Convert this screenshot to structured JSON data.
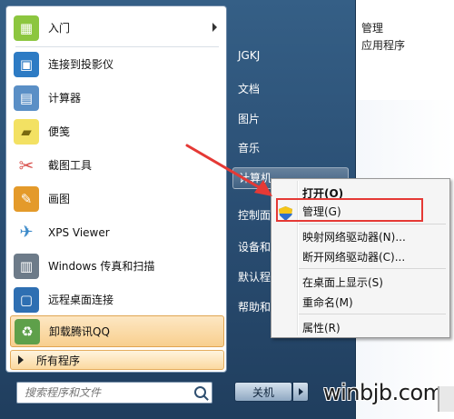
{
  "background_window": {
    "items": [
      "管理",
      "应用程序"
    ]
  },
  "programs": [
    {
      "label": "入门",
      "icon": "getting-started-icon",
      "color": "#8cc63f",
      "has_submenu": true
    },
    {
      "label": "连接到投影仪",
      "icon": "projector-icon",
      "color": "#2d7bc4"
    },
    {
      "label": "计算器",
      "icon": "calculator-icon",
      "color": "#5a8fc6"
    },
    {
      "label": "便笺",
      "icon": "sticky-notes-icon",
      "color": "#f3e163"
    },
    {
      "label": "截图工具",
      "icon": "scissors-icon",
      "color": "#d9534f"
    },
    {
      "label": "画图",
      "icon": "paint-icon",
      "color": "#e49a2a"
    },
    {
      "label": "XPS Viewer",
      "icon": "xps-viewer-icon",
      "color": "#3a89c9"
    },
    {
      "label": "Windows 传真和扫描",
      "icon": "fax-scanner-icon",
      "color": "#6d7b89"
    },
    {
      "label": "远程桌面连接",
      "icon": "remote-desktop-icon",
      "color": "#2e6fb2"
    },
    {
      "label": "卸载腾讯QQ",
      "icon": "uninstall-icon",
      "color": "#5ea04a",
      "highlighted": true
    }
  ],
  "all_programs": "所有程序",
  "search": {
    "placeholder": "搜索程序和文件"
  },
  "right_pane": [
    {
      "label": "JGKJ"
    },
    {
      "label": "文档"
    },
    {
      "label": "图片"
    },
    {
      "label": "音乐"
    },
    {
      "label": "计算机",
      "selected": true
    },
    {
      "label": "控制面"
    },
    {
      "label": "设备和"
    },
    {
      "label": "默认程"
    },
    {
      "label": "帮助和"
    }
  ],
  "shutdown": {
    "label": "关机"
  },
  "context_menu": {
    "items": [
      {
        "label": "打开(O)",
        "bold": true
      },
      {
        "label": "管理(G)",
        "icon": "uac-shield-icon"
      },
      {
        "label": "映射网络驱动器(N)..."
      },
      {
        "label": "断开网络驱动器(C)..."
      },
      {
        "label": "在桌面上显示(S)"
      },
      {
        "label": "重命名(M)"
      },
      {
        "label": "属性(R)"
      }
    ]
  },
  "watermark": "winbjb.com",
  "colors": {
    "annotation_red": "#e53935",
    "taskbar_blue": "#2a4e73",
    "highlight_orange": "#f8cf8e"
  }
}
